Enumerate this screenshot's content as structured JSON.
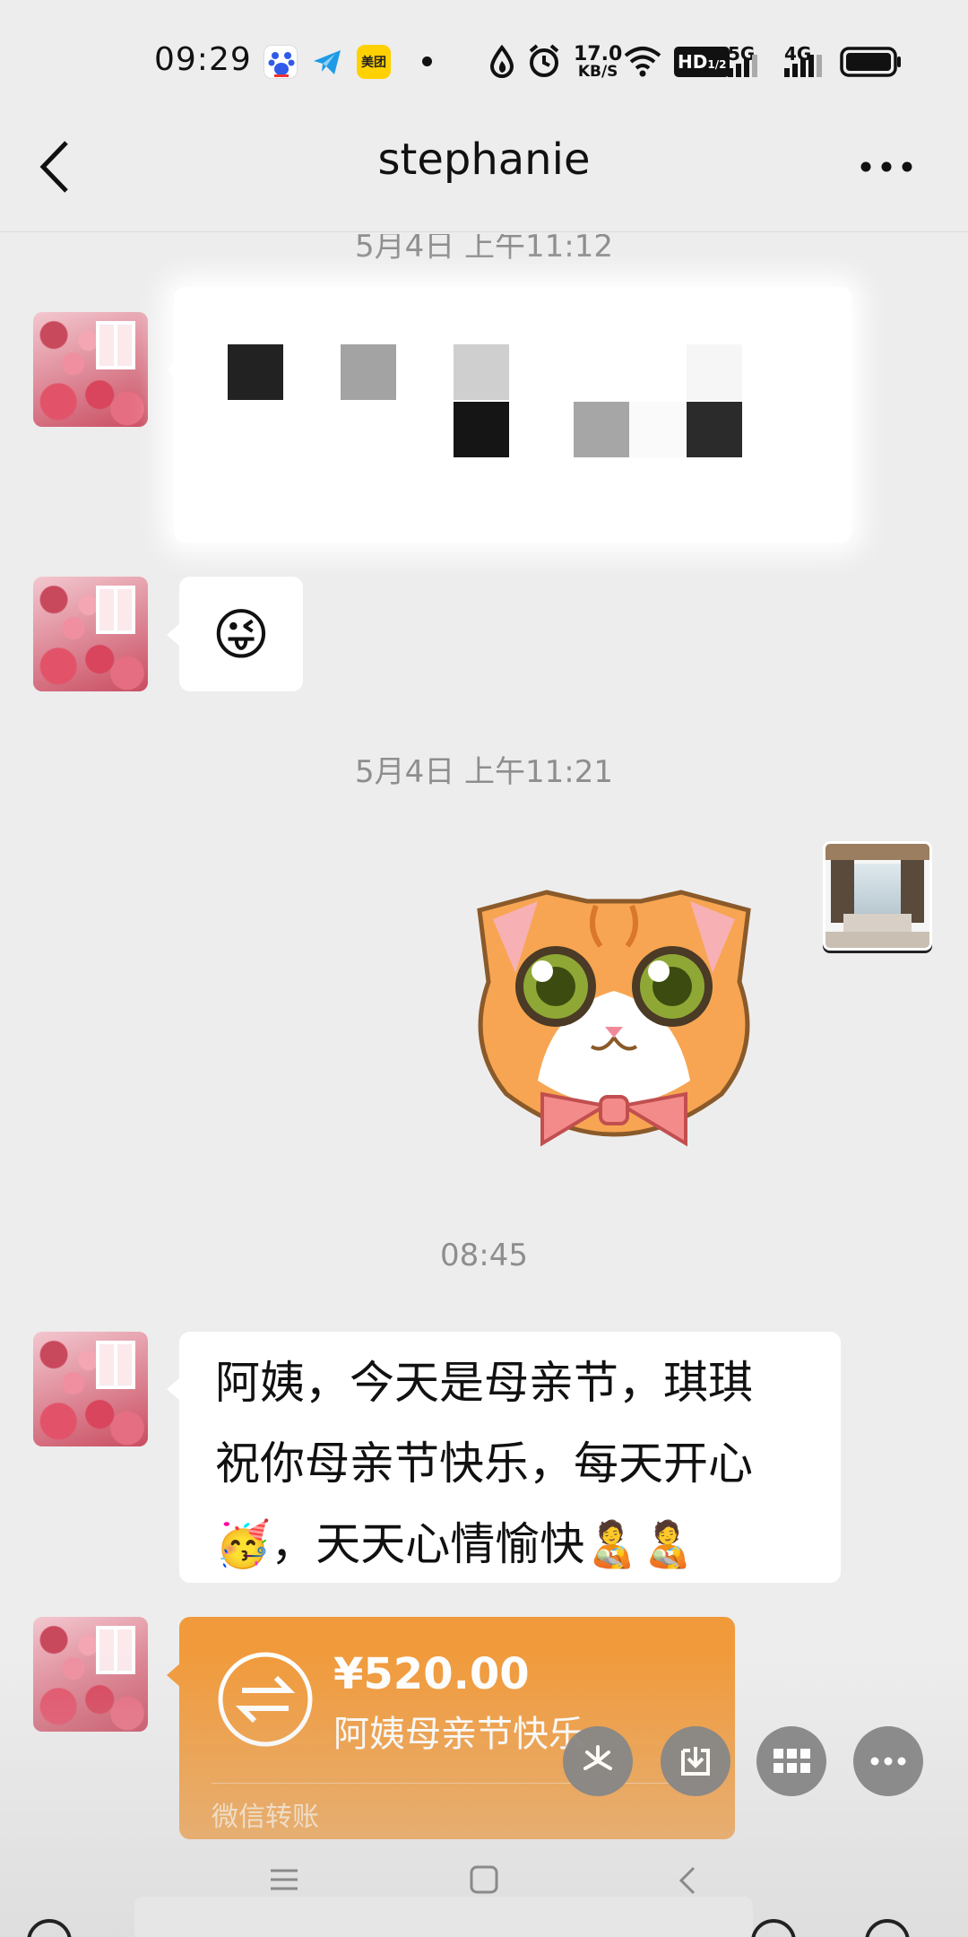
{
  "status_bar": {
    "time": "09:29",
    "net_speed_value": "17.0",
    "net_speed_unit": "KB/S",
    "hd_label": "HD",
    "net_5g": "5G",
    "net_4g": "4G",
    "meituan": "美团"
  },
  "header": {
    "title": "stephanie",
    "back_icon": "chevron-left-icon",
    "more_icon": "more-dots-icon"
  },
  "messages": {
    "timestamp_1": "5月4日 上午11:12",
    "timestamp_2": "5月4日 上午11:21",
    "timestamp_3": "08:45",
    "emoji_message": "😜",
    "text_message": "阿姨，今天是母亲节，琪琪祝你母亲节快乐，每天开心🥳，天天心情愉快🙎‍♂️🙎‍♂️",
    "text_line_1": "阿姨，今天是母亲节，琪琪",
    "text_line_2": "祝你母亲节快乐，每天开心",
    "text_line_3_a": "🥳，天天心情愉快",
    "text_line_3_b": "🧑‍🍼🧑‍🍼"
  },
  "transfer": {
    "amount": "¥520.00",
    "note": "阿姨母亲节快乐",
    "footer": "微信转账",
    "icon": "transfer-arrows-icon"
  },
  "floating_actions": [
    "pinwheel-icon",
    "save-download-icon",
    "grid-icon",
    "more-dots-icon"
  ],
  "nav_bar": [
    "menu-icon",
    "home-square-icon",
    "back-chevron-icon"
  ],
  "colors": {
    "background": "#ededed",
    "transfer": "#f19a3b",
    "bubble": "#ffffff",
    "timestamp": "#8e8e8e"
  }
}
